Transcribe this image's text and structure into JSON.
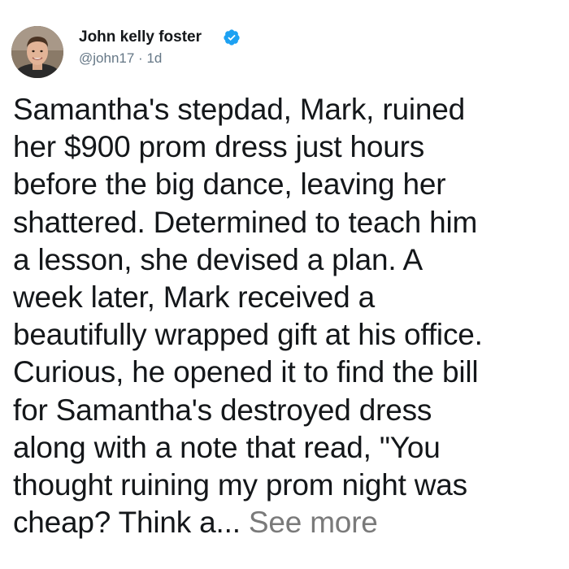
{
  "author": {
    "name": "John kelly foster",
    "handle": "@john17",
    "separator": "·",
    "time": "1d",
    "verified": true
  },
  "tweet": {
    "lines": [
      "Samantha's stepdad, Mark, ruined",
      "her $900 prom dress just hours",
      "before the big dance, leaving her",
      "shattered. Determined to teach him",
      "a lesson, she devised a plan. A",
      "week later, Mark received a",
      "beautifully wrapped gift at his office.",
      "Curious, he opened it to find the bill",
      "for Samantha's destroyed dress",
      "along with a note that read, \"You",
      "thought ruining my prom night was",
      "cheap? Think a..."
    ],
    "see_more": "See more"
  },
  "colors": {
    "verified": "#1da1f2",
    "text": "#14171a",
    "muted": "#657786",
    "see_more": "#7a7a7a"
  },
  "icons": {
    "verified": "verified-badge-icon",
    "avatar": "profile-photo"
  }
}
